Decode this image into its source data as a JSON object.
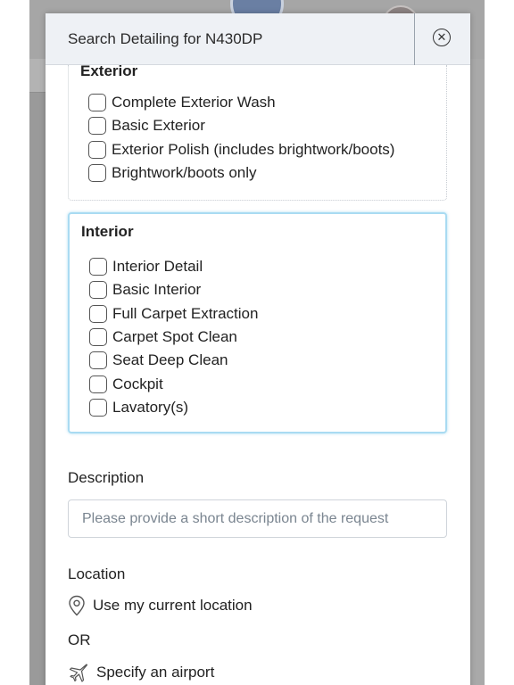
{
  "modal": {
    "title": "Search Detailing for N430DP",
    "close_icon": "close-circle-icon"
  },
  "exterior": {
    "title": "Exterior",
    "options": [
      "Complete Exterior Wash",
      "Basic Exterior",
      "Exterior Polish (includes brightwork/boots)",
      "Brightwork/boots only"
    ]
  },
  "interior": {
    "title": "Interior",
    "options": [
      "Interior Detail",
      "Basic Interior",
      "Full Carpet Extraction",
      "Carpet Spot Clean",
      "Seat Deep Clean",
      "Cockpit",
      "Lavatory(s)"
    ]
  },
  "description": {
    "label": "Description",
    "placeholder": "Please provide a short description of the request",
    "value": ""
  },
  "location": {
    "label": "Location",
    "current_location": "Use my current location",
    "or": "OR",
    "specify_airport": "Specify an airport"
  },
  "colors": {
    "header_bg": "#eef1f5",
    "interior_focus_border": "#a9dbf2",
    "overlay": "#9a9a9a"
  }
}
